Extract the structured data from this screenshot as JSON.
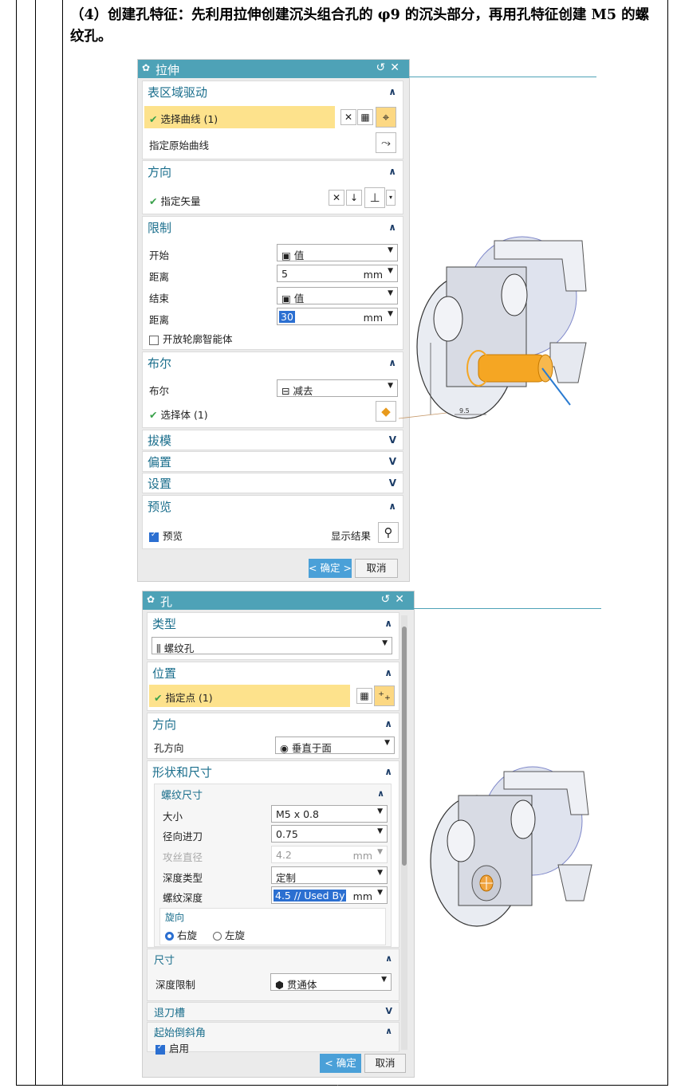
{
  "heading": "（4）创建孔特征：先利用拉伸创建沉头组合孔的 φ9 的沉头部分，再用孔特征创建 M5 的螺纹孔。",
  "icons": {
    "gear": "gear-icon",
    "reset": "reset-icon",
    "close": "close-icon",
    "check": "check-icon",
    "chevron": "chevron-icon"
  },
  "colors": {
    "title_bar": "#4ea2b7",
    "highlight": "#fde28c",
    "ok_button": "#4aa0d8",
    "section_header": "#1a6e8c",
    "model_orange": "#f5a623"
  },
  "extrude": {
    "title": "拉伸",
    "section_drive": {
      "header": "表区域驱动",
      "select_curve": "选择曲线 (1)",
      "origin_curve": "指定原始曲线"
    },
    "section_direction": {
      "header": "方向",
      "vector": "指定矢量"
    },
    "section_limits": {
      "header": "限制",
      "start_label": "开始",
      "start_value": "值",
      "dist1_label": "距离",
      "dist1_value": "5",
      "unit": "mm",
      "end_label": "结束",
      "end_value": "值",
      "dist2_label": "距离",
      "dist2_value": "30",
      "open_profile": "开放轮廓智能体"
    },
    "section_bool": {
      "header": "布尔",
      "bool_label": "布尔",
      "bool_value": "减去",
      "select_body": "选择体 (1)"
    },
    "section_draft": "拔模",
    "section_offset": "偏置",
    "section_settings": "设置",
    "section_preview": {
      "header": "预览",
      "preview": "预览",
      "show_result": "显示结果"
    },
    "ok": "< 确定 >",
    "cancel": "取消",
    "dim_label": "9.5"
  },
  "hole": {
    "title": "孔",
    "section_type": {
      "header": "类型",
      "value": "螺纹孔"
    },
    "section_position": {
      "header": "位置",
      "point": "指定点 (1)"
    },
    "section_direction": {
      "header": "方向",
      "label": "孔方向",
      "value": "垂直于面"
    },
    "section_shape": {
      "header": "形状和尺寸",
      "thread": {
        "header": "螺纹尺寸",
        "size_label": "大小",
        "size_value": "M5 x 0.8",
        "radial_label": "径向进刀",
        "radial_value": "0.75",
        "tap_label": "攻丝直径",
        "tap_value": "4.2",
        "tap_unit": "mm",
        "depth_type_label": "深度类型",
        "depth_type_value": "定制",
        "depth_label": "螺纹深度",
        "depth_value": "4.5 // Used By",
        "depth_unit": "mm"
      },
      "hand": {
        "header": "旋向",
        "right": "右旋",
        "left": "左旋"
      }
    },
    "section_dim": {
      "header": "尺寸",
      "limit_label": "深度限制",
      "limit_value": "贯通体"
    },
    "section_relief": "退刀槽",
    "section_chamfer": {
      "header": "起始倒斜角",
      "enable": "启用"
    },
    "ok": "< 确定 >",
    "cancel": "取消"
  }
}
